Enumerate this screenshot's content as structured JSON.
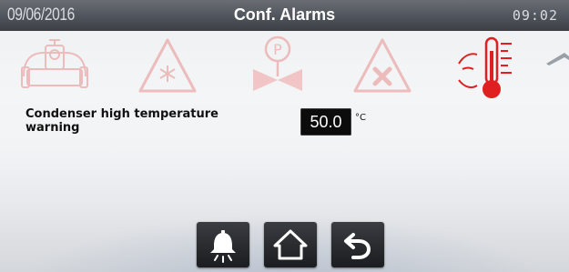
{
  "header": {
    "date": "09/06/2016",
    "title": "Conf. Alarms",
    "time": "09:02"
  },
  "alarm_categories": [
    {
      "icon": "flowmeter-sensor-icon",
      "state": "inactive"
    },
    {
      "icon": "frost-warning-icon",
      "state": "inactive"
    },
    {
      "icon": "pressure-valve-icon",
      "state": "inactive"
    },
    {
      "icon": "general-alarm-icon",
      "state": "inactive"
    },
    {
      "icon": "condenser-temperature-icon",
      "state": "active"
    },
    {
      "icon": "scroll-up-icon",
      "state": "inactive"
    }
  ],
  "setting": {
    "label_line1": "Condenser high temperature",
    "label_line2": "warning",
    "value": "50.0",
    "unit": "°C"
  },
  "toolbar": {
    "buttons": [
      {
        "icon": "alarm-bell-icon"
      },
      {
        "icon": "home-icon"
      },
      {
        "icon": "back-icon"
      }
    ]
  },
  "colors": {
    "accent_red": "#e02020",
    "faded_red": "#f0a0a0",
    "header_bg": "#4a4e54",
    "value_bg": "#0c0c0c"
  }
}
